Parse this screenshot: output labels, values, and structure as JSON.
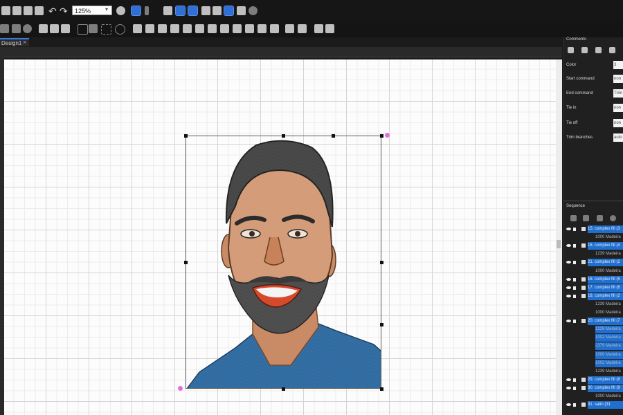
{
  "toolbar": {
    "zoom_value": "125%",
    "row1_icons": [
      "file-icon",
      "new-icon",
      "save-icon",
      "print-icon",
      "undo-icon",
      "redo-icon",
      "zoom-fit-icon",
      "select-tool-icon",
      "needle-icon",
      "3d-view-icon",
      "grid-view-icon",
      "stitch-view-icon",
      "nodes-icon",
      "image-icon",
      "flag-icon",
      "frame-icon",
      "hoop-icon"
    ],
    "row2_icons": [
      "move-icon",
      "rotate-icon",
      "gear-icon",
      "copy-icon",
      "paste-icon",
      "delete-icon",
      "rect-select-icon",
      "lasso-icon",
      "circle-select-icon",
      "mirror-h-icon",
      "mirror-v-icon",
      "rotate-left-icon",
      "rotate-right-icon",
      "align-left-icon",
      "align-center-icon",
      "align-right-icon",
      "align-top-icon",
      "align-middle-icon",
      "align-bottom-icon",
      "group-icon",
      "ungroup-icon",
      "combine-icon",
      "break-icon",
      "resize-icon",
      "fit-icon"
    ]
  },
  "document": {
    "tab_label": "Design1",
    "close_glyph": "×"
  },
  "comments_panel": {
    "title": "Comments",
    "fields": [
      {
        "label": "Color",
        "value": "3"
      },
      {
        "label": "Start command",
        "value": "non"
      },
      {
        "label": "End command",
        "value": "Trim"
      },
      {
        "label": "Tie in",
        "value": "non"
      },
      {
        "label": "Tie off",
        "value": "non"
      },
      {
        "label": "Trim branches",
        "value": "auto"
      }
    ]
  },
  "sequence_panel": {
    "title": "Sequence",
    "rows": [
      {
        "text": "15. complex fill (3",
        "selected": true,
        "sub": false
      },
      {
        "text": "1000 Madeira",
        "selected": false,
        "sub": true
      },
      {
        "text": "16. complex fill (4",
        "selected": true,
        "sub": false
      },
      {
        "text": "1239 Madeira",
        "selected": false,
        "sub": true
      },
      {
        "text": "21. complex fill (2",
        "selected": true,
        "sub": false
      },
      {
        "text": "1000 Madeira",
        "selected": false,
        "sub": true
      },
      {
        "text": "16. complex fill (5",
        "selected": true,
        "sub": false
      },
      {
        "text": "17. complex fill (6",
        "selected": true,
        "sub": false
      },
      {
        "text": "18. complex fill (2",
        "selected": true,
        "sub": false
      },
      {
        "text": "1239 Madeira",
        "selected": false,
        "sub": true
      },
      {
        "text": "1000 Madeira",
        "selected": false,
        "sub": true
      },
      {
        "text": "20. complex fill (7",
        "selected": true,
        "sub": false
      },
      {
        "text": "1239 Madeira",
        "selected": true,
        "sub": true
      },
      {
        "text": "1002 Madeira",
        "selected": true,
        "sub": true
      },
      {
        "text": "2379 Madeira",
        "selected": true,
        "sub": true
      },
      {
        "text": "1000 Madeira",
        "selected": true,
        "sub": true
      },
      {
        "text": "1002 Madeira",
        "selected": true,
        "sub": true
      },
      {
        "text": "1239 Madeira",
        "selected": false,
        "sub": true
      },
      {
        "text": "29. complex fill (8",
        "selected": true,
        "sub": false
      },
      {
        "text": "30. complex fill (9",
        "selected": true,
        "sub": false
      },
      {
        "text": "1000 Madeira",
        "selected": false,
        "sub": true
      },
      {
        "text": "31. satin (31",
        "selected": true,
        "sub": false
      }
    ]
  },
  "colors": {
    "selection_blue": "#1f6fd1",
    "tab_accent": "#3b7be0",
    "canvas": "#fcfcfc"
  }
}
